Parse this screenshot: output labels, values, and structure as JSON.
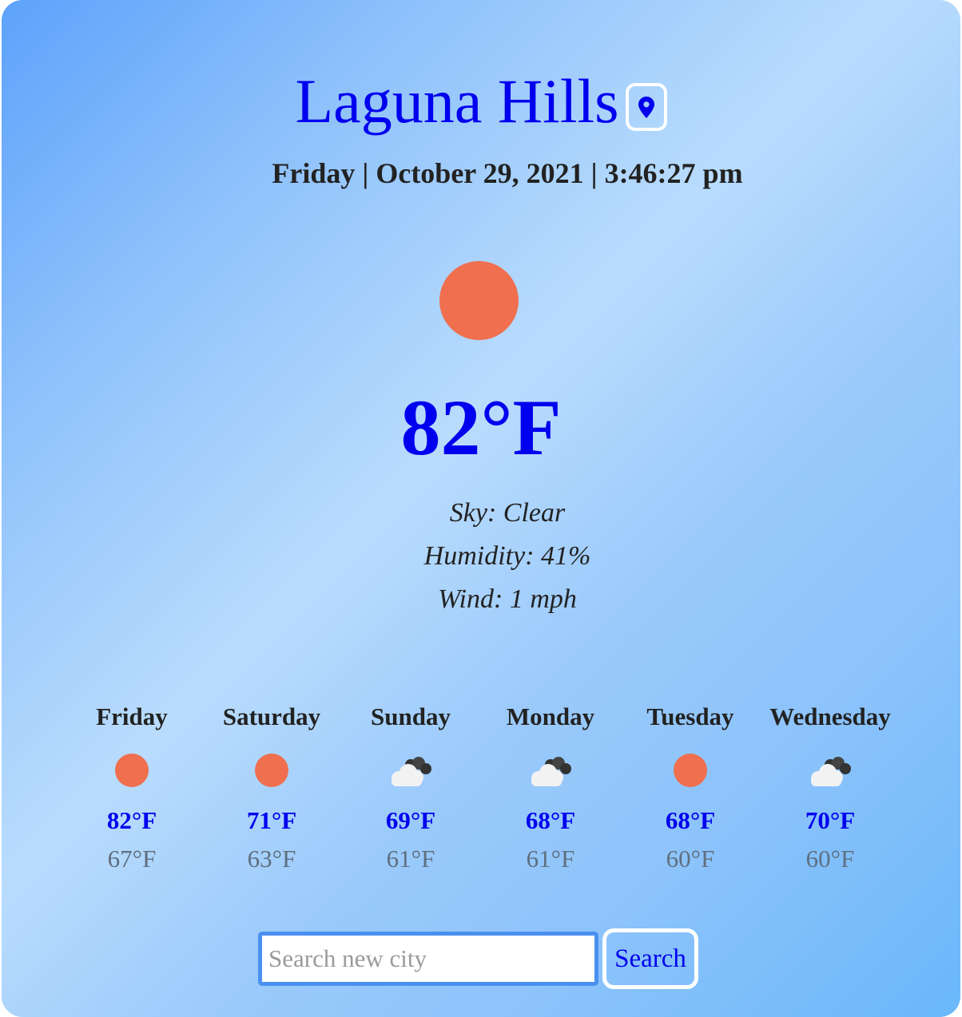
{
  "location": {
    "city": "Laguna Hills",
    "locate_icon": "map-pin-icon"
  },
  "datetime": "Friday | October 29, 2021 | 3:46:27 pm",
  "current": {
    "icon": "sun-icon",
    "temperature": "82°F",
    "sky": "Sky: Clear",
    "humidity": "Humidity: 41%",
    "wind": "Wind: 1 mph"
  },
  "forecast": [
    {
      "day": "Friday",
      "icon": "sun-icon",
      "high": "82°F",
      "low": "67°F"
    },
    {
      "day": "Saturday",
      "icon": "sun-icon",
      "high": "71°F",
      "low": "63°F"
    },
    {
      "day": "Sunday",
      "icon": "cloud-icon",
      "high": "69°F",
      "low": "61°F"
    },
    {
      "day": "Monday",
      "icon": "cloud-icon",
      "high": "68°F",
      "low": "61°F"
    },
    {
      "day": "Tuesday",
      "icon": "sun-icon",
      "high": "68°F",
      "low": "60°F"
    },
    {
      "day": "Wednesday",
      "icon": "cloud-icon",
      "high": "70°F",
      "low": "60°F"
    }
  ],
  "search": {
    "placeholder": "Search new city",
    "value": "",
    "button_label": "Search"
  },
  "colors": {
    "accent": "#0000ee",
    "sun": "#ef6f4f",
    "text": "#222222",
    "low_temp": "#5f6f7f"
  }
}
